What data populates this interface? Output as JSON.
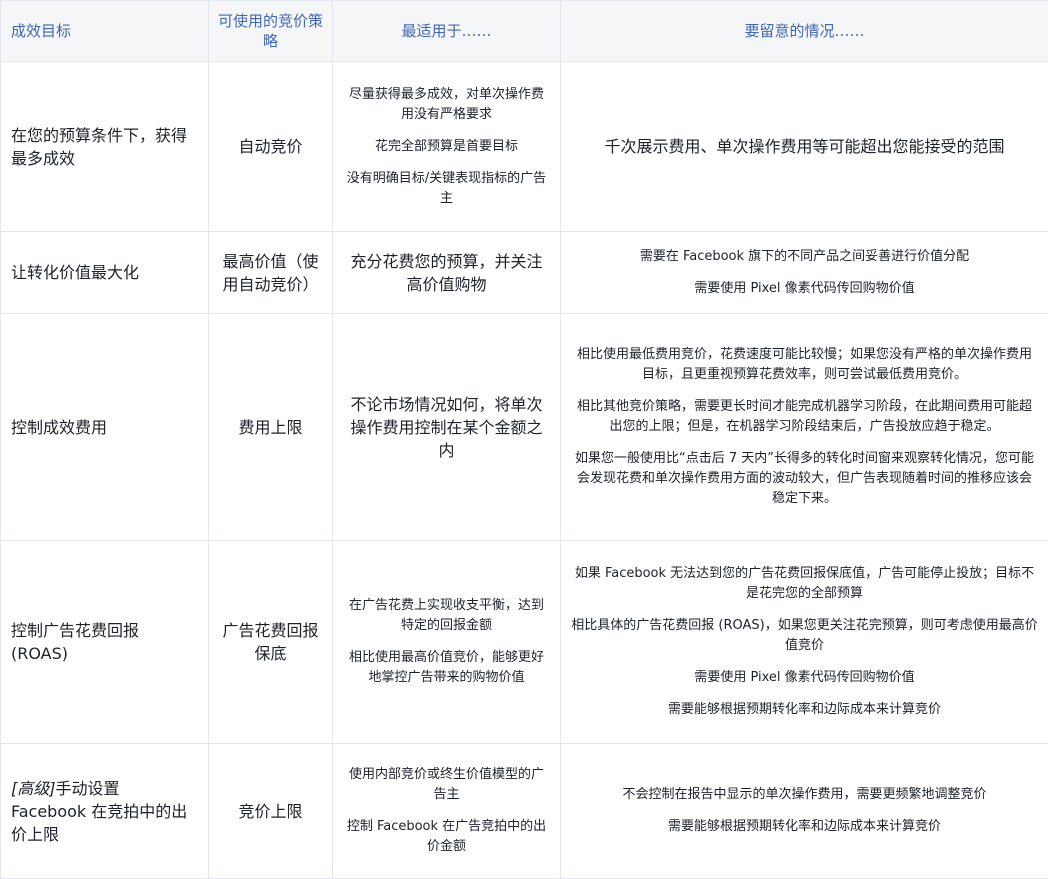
{
  "header": {
    "goal": "成效目标",
    "strategy": "可使用的竞价策略",
    "best_for": "最适用于……",
    "watch_for": "要留意的情况……"
  },
  "rows": [
    {
      "goal": "在您的预算条件下，获得最多成效",
      "strategy": "自动竞价",
      "best_for": [
        "尽量获得最多成效，对单次操作费用没有严格要求",
        "花完全部预算是首要目标",
        "没有明确目标/关键表现指标的广告主"
      ],
      "watch_for": [
        "千次展示费用、单次操作费用等可能超出您能接受的范围"
      ]
    },
    {
      "goal": "让转化价值最大化",
      "strategy": "最高价值（使用自动竞价）",
      "best_for": [
        "充分花费您的预算，并关注高价值购物"
      ],
      "watch_for": [
        "需要在 Facebook 旗下的不同产品之间妥善进行价值分配",
        "需要使用 Pixel 像素代码传回购物价值"
      ]
    },
    {
      "goal": "控制成效费用",
      "strategy": "费用上限",
      "best_for": [
        "不论市场情况如何，将单次操作费用控制在某个金额之内"
      ],
      "watch_for": [
        "相比使用最低费用竞价，花费速度可能比较慢；如果您没有严格的单次操作费用目标，且更重视预算花费效率，则可尝试最低费用竞价。",
        "相比其他竞价策略，需要更长时间才能完成机器学习阶段，在此期间费用可能超出您的上限；但是，在机器学习阶段结束后，广告投放应趋于稳定。",
        "如果您一般使用比“点击后 7 天内”长得多的转化时间窗来观察转化情况，您可能会发现花费和单次操作费用方面的波动较大，但广告表现随着时间的推移应该会稳定下来。"
      ]
    },
    {
      "goal": "控制广告花费回报 (ROAS)",
      "strategy": "广告花费回报保底",
      "best_for": [
        "在广告花费上实现收支平衡，达到特定的回报金额",
        "相比使用最高价值竞价，能够更好地掌控广告带来的购物价值"
      ],
      "watch_for": [
        "如果 Facebook 无法达到您的广告花费回报保底值，广告可能停止投放；目标不是花完您的全部预算",
        "相比具体的广告花费回报 (ROAS)，如果您更关注花完预算，则可考虑使用最高价值竞价",
        "需要使用 Pixel 像素代码传回购物价值",
        "需要能够根据预期转化率和边际成本来计算竞价"
      ]
    },
    {
      "goal_prefix": "[高级]",
      "goal": "手动设置 Facebook 在竞拍中的出价上限",
      "strategy": "竞价上限",
      "best_for": [
        "使用内部竞价或终生价值模型的广告主",
        "控制 Facebook 在广告竞拍中的出价金额"
      ],
      "watch_for": [
        "不会控制在报告中显示的单次操作费用，需要更频繁地调整竞价",
        "需要能够根据预期转化率和边际成本来计算竞价"
      ]
    }
  ],
  "colors": {
    "header_text": "#4267b2",
    "header_bg": "#f5f6f7",
    "border": "#e3e6ec",
    "body_text": "#1d2129"
  }
}
